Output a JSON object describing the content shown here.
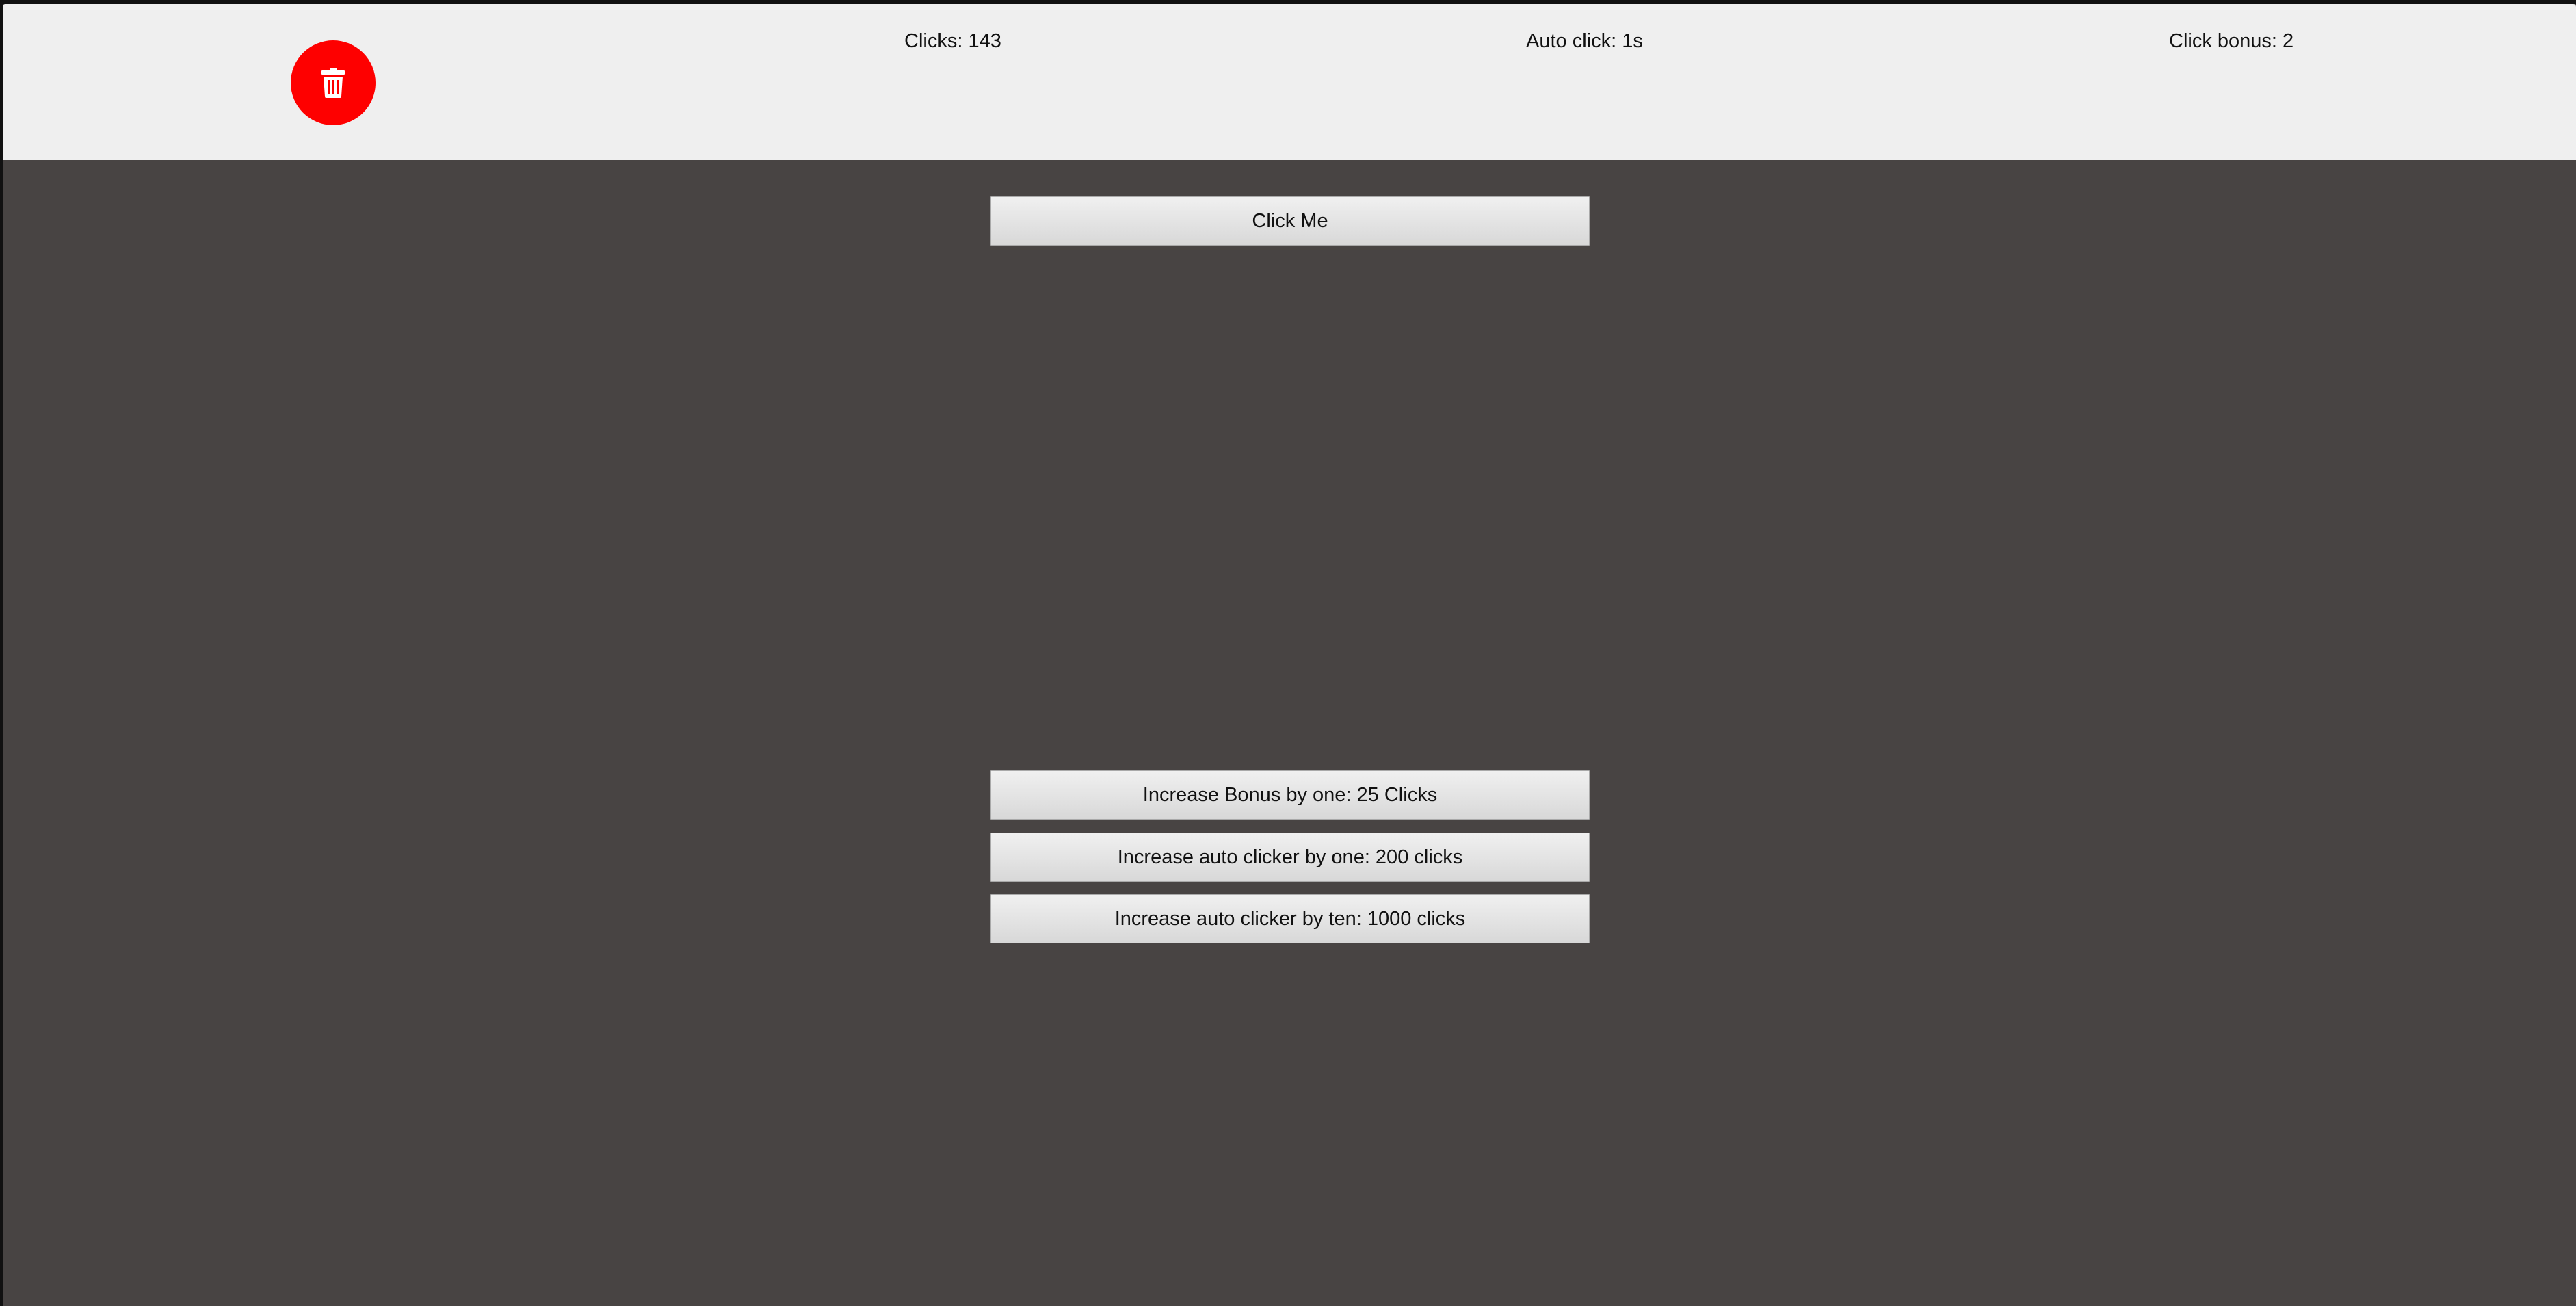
{
  "header": {
    "reset_icon": "trash-icon",
    "reset_color": "#fe0000",
    "clicks_text": "Clicks: 143",
    "auto_click_text": "Auto click: 1s",
    "click_bonus_text": "Click bonus: 2"
  },
  "main": {
    "click_button_label": "Click Me",
    "upgrades": [
      {
        "label": "Increase Bonus by one: 25 Clicks"
      },
      {
        "label": "Increase auto clicker by one: 200 clicks"
      },
      {
        "label": "Increase auto clicker by ten: 1000 clicks"
      }
    ]
  },
  "colors": {
    "header_background": "#efefef",
    "page_background": "#484443",
    "button_background": "#e4e4e4"
  }
}
